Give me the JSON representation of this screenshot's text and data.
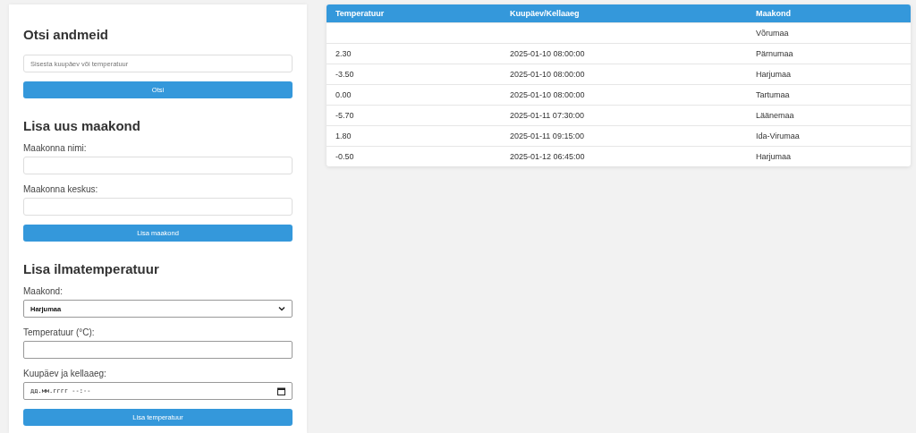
{
  "search": {
    "title": "Otsi andmeid",
    "placeholder": "Sisesta kuupäev või temperatuur",
    "button": "Otsi"
  },
  "add_county": {
    "title": "Lisa uus maakond",
    "fields": [
      {
        "label": "Maakonna nimi:"
      },
      {
        "label": "Maakonna keskus:"
      }
    ],
    "button": "Lisa maakond"
  },
  "add_temperature": {
    "title": "Lisa ilmatemperatuur",
    "fields": [
      {
        "kind": "select",
        "label": "Maakond:",
        "value": "Harjumaa"
      },
      {
        "kind": "text",
        "label": "Temperatuur (°C):"
      },
      {
        "kind": "datetime",
        "label": "Kuupäev ja kellaaeg:",
        "placeholder": "дд.мм.гггг --:--"
      }
    ],
    "button": "Lisa temperatuur"
  },
  "table": {
    "columns": [
      "Temperatuur",
      "Kuupäev/Kellaaeg",
      "Maakond"
    ],
    "rows": [
      {
        "county": "Võrumaa"
      },
      {
        "temperature": "2.30",
        "datetime": "2025-01-10 08:00:00",
        "county": "Pärnumaa"
      },
      {
        "temperature": "-3.50",
        "datetime": "2025-01-10 08:00:00",
        "county": "Harjumaa"
      },
      {
        "temperature": "0.00",
        "datetime": "2025-01-10 08:00:00",
        "county": "Tartumaa"
      },
      {
        "temperature": "-5.70",
        "datetime": "2025-01-11 07:30:00",
        "county": "Läänemaa"
      },
      {
        "temperature": "1.80",
        "datetime": "2025-01-11 09:15:00",
        "county": "Ida-Virumaa"
      },
      {
        "temperature": "-0.50",
        "datetime": "2025-01-12 06:45:00",
        "county": "Harjumaa"
      }
    ]
  }
}
